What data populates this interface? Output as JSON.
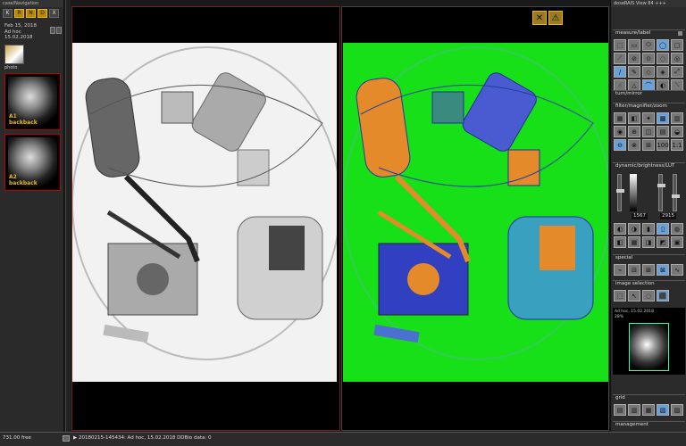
{
  "window": {
    "title": "case/Navigation"
  },
  "left": {
    "nav_buttons": [
      "K",
      "R",
      "N",
      "D",
      "X"
    ],
    "case": {
      "date": "Feb 15, 2018",
      "name": "Ad hoc",
      "short_date": "15.02.2018"
    },
    "photo_label": "photo",
    "scans": [
      {
        "label": "A1\nbackback"
      },
      {
        "label": "A2\nbackback"
      }
    ]
  },
  "viewer": {
    "warnings": [
      {
        "icon": "x2-warning-icon",
        "glyph": "✕"
      },
      {
        "icon": "alert-triangle-icon",
        "glyph": "⚠"
      }
    ]
  },
  "right": {
    "title": "doseRAIS View 84 +++",
    "sections": {
      "measure": "measure/label",
      "turn": "turn/mirror",
      "filter": "filter/magnifier/zoom",
      "dynamic": "dynamic/brightness/LUT",
      "special": "special",
      "image_selection": "image selection",
      "grid": "grid",
      "management": "management"
    },
    "measure_tools": [
      "⬚",
      "▭",
      "⬭",
      "◯",
      "▢",
      "⟋",
      "⊘",
      "⊙",
      "◌",
      "◎",
      "/",
      "✎",
      "◇",
      "◈",
      "⤢",
      "☝",
      "△",
      "⌒",
      "◐",
      "⟍"
    ],
    "turn_tools": [
      "↻",
      "↺",
      "⇋"
    ],
    "filter_tools": [
      "▦",
      "◧",
      "✦",
      "▩",
      "▥",
      "◉",
      "⊕",
      "◫",
      "▤",
      "◒",
      "⊖",
      "⊗",
      "⊞",
      "100",
      "1:1"
    ],
    "dynamic_values": {
      "min": "1567",
      "max": "2915"
    },
    "dynamic_tools": [
      "◐",
      "◑",
      "▮",
      "▯",
      "◍",
      "◧",
      "▦",
      "◨",
      "◩",
      "▣"
    ],
    "special_tools": [
      "⌁",
      "⊟",
      "⊞",
      "⊠",
      "∿"
    ],
    "selection_tools": [
      "⬚",
      "↖",
      "◌",
      "⬛"
    ],
    "mini": {
      "title": "Ad hoc, 15.02.2018",
      "zoom": "28%"
    },
    "grid_tools": [
      "▤",
      "▥",
      "▦",
      "▧",
      "▨"
    ]
  },
  "status": {
    "free": "731.00 free",
    "main": "▶ 20180215-145434: Ad hoc, 15.02.2018  DDBio data: 0"
  },
  "colors": {
    "accent": "#e5b530",
    "selected_border": "#b00000",
    "false_color_bg": "#18e018",
    "organic": "#e58a2a",
    "metal": "#3040c0"
  }
}
